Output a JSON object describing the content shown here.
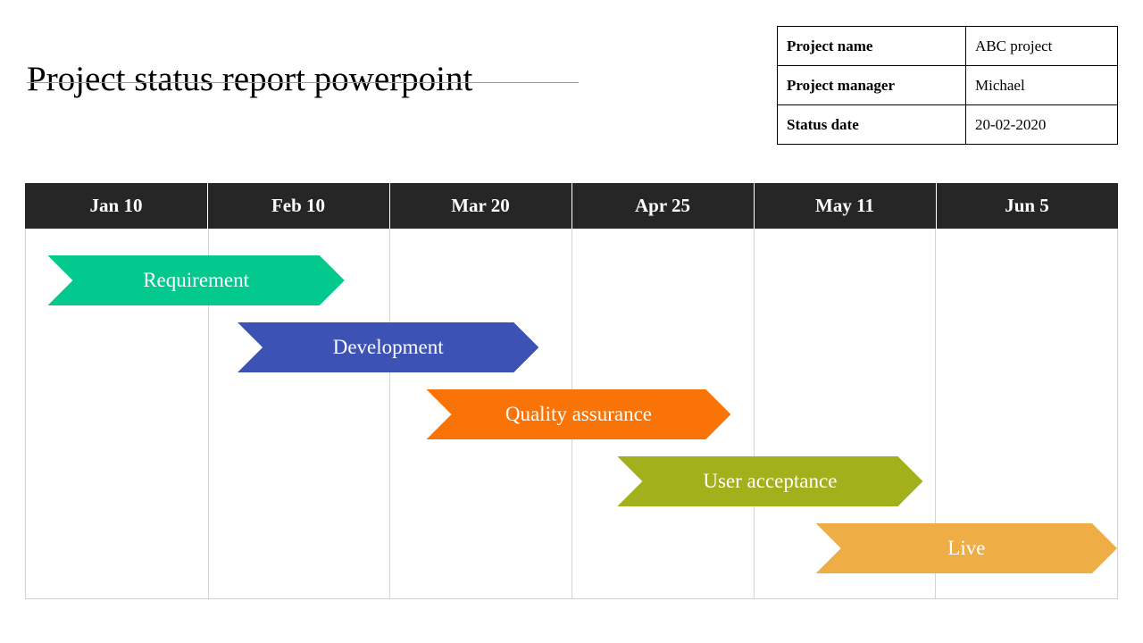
{
  "slide": {
    "title": "Project status report powerpoint"
  },
  "info_table": {
    "rows": [
      {
        "label": "Project name",
        "value": "ABC project"
      },
      {
        "label": "Project manager",
        "value": "Michael"
      },
      {
        "label": "Status date",
        "value": "20-02-2020"
      }
    ]
  },
  "chart_data": {
    "type": "bar",
    "title": "Project status report powerpoint",
    "xlabel": "",
    "ylabel": "",
    "grid": true,
    "legend_position": "none",
    "axis_type": "timeline",
    "categories": [
      "Jan 10",
      "Feb 10",
      "Mar 20",
      "Apr 25",
      "May 11",
      "Jun 5"
    ],
    "header_background": "#262626",
    "header_text_color": "#ffffff",
    "gridline_color": "#d4d4d4",
    "tasks": [
      {
        "name": "Requirement",
        "color": "#04c98e",
        "start_pct": 2.0,
        "end_pct": 29.2,
        "row": 0,
        "start_label": "Jan 10",
        "end_label": "Feb 10"
      },
      {
        "name": "Development",
        "color": "#3d52b5",
        "start_pct": 19.4,
        "end_pct": 47.0,
        "row": 1,
        "start_label": "Feb 10",
        "end_label": "Mar 20"
      },
      {
        "name": "Quality assurance",
        "color": "#f97306",
        "start_pct": 36.7,
        "end_pct": 64.6,
        "row": 2,
        "start_label": "Mar 20",
        "end_label": "Apr 25"
      },
      {
        "name": "User acceptance",
        "color": "#a2b01c",
        "start_pct": 54.2,
        "end_pct": 82.2,
        "row": 3,
        "start_label": "Apr 25",
        "end_label": "May 11"
      },
      {
        "name": "Live",
        "color": "#efad45",
        "start_pct": 72.4,
        "end_pct": 100.0,
        "row": 4,
        "start_label": "May 11",
        "end_label": "Jun 5"
      }
    ]
  }
}
